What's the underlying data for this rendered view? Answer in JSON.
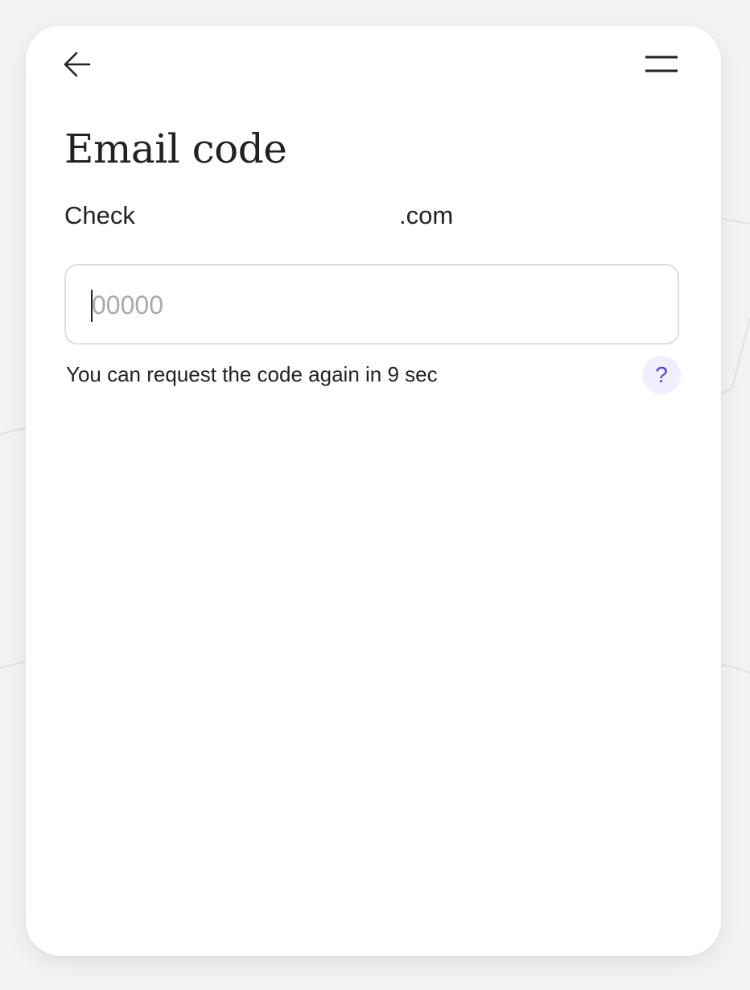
{
  "header": {
    "back_icon": "arrow-left-icon",
    "menu_icon": "hamburger-menu-icon"
  },
  "page": {
    "title": "Email code",
    "subtitle_prefix": "Check",
    "subtitle_email_suffix": ".com"
  },
  "code_input": {
    "value": "",
    "placeholder": "00000"
  },
  "resend": {
    "text": "You can request the code again in 9 sec"
  },
  "help": {
    "label": "?",
    "icon": "question-mark-icon"
  },
  "colors": {
    "accent": "#5b3fd6",
    "help_bg": "#f1efff",
    "text": "#222222",
    "placeholder": "#a9a9a9"
  }
}
